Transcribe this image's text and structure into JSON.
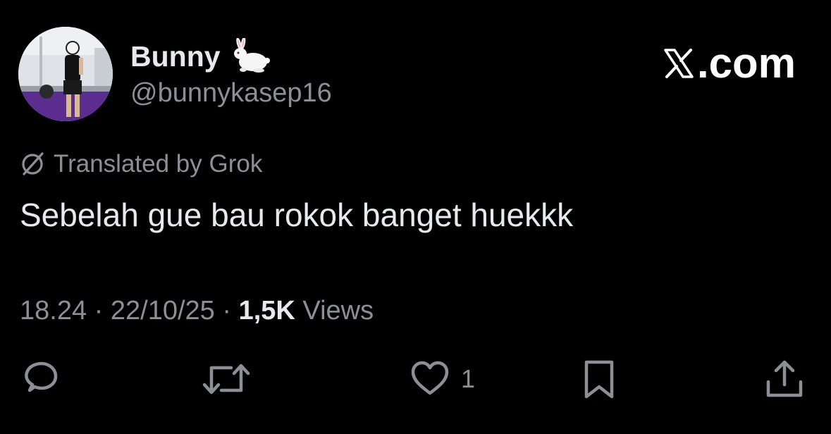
{
  "author": {
    "display_name": "Bunny",
    "handle": "@bunnykasep16",
    "name_emoji": "rabbit-emoji",
    "avatar": "profile-photo"
  },
  "brand": {
    "text": ".com",
    "logo_icon": "x-logo-icon"
  },
  "translation": {
    "icon": "grok-icon",
    "label": "Translated by Grok"
  },
  "tweet": {
    "text": "Sebelah gue bau rokok banget huekkk"
  },
  "meta": {
    "time": "18.24",
    "separator": "·",
    "date": "22/10/25",
    "views_count": "1,5K",
    "views_label": "Views"
  },
  "actions": {
    "reply_icon": "reply-icon",
    "retweet_icon": "retweet-icon",
    "like_icon": "heart-icon",
    "like_count": "1",
    "bookmark_icon": "bookmark-icon",
    "share_icon": "share-icon"
  },
  "colors": {
    "background": "#000000",
    "primary_text": "#e7e9ea",
    "secondary_text": "#8b9097",
    "avatar_accent": "#5b2d8f"
  }
}
